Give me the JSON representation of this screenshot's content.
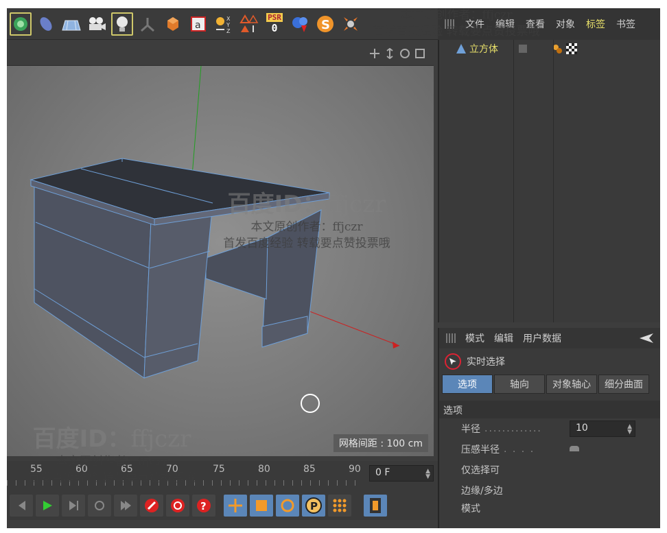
{
  "menubar": {
    "items": [
      "文件",
      "编辑",
      "查看",
      "对象",
      "标签",
      "书签"
    ],
    "active_index": 4
  },
  "toolbar": {
    "psr_label": "PSR",
    "psr_value": "0",
    "axis_labels": "X Y Z"
  },
  "objects": {
    "cube_label": "立方体"
  },
  "viewport": {
    "grid_label": "网格间距 : 100 cm"
  },
  "timeline": {
    "ticks": [
      "55",
      "60",
      "65",
      "70",
      "75",
      "80",
      "85",
      "90"
    ],
    "current_frame": "0 F"
  },
  "attributes": {
    "menu": [
      "模式",
      "编辑",
      "用户数据"
    ],
    "tool_name": "实时选择",
    "tabs": [
      "选项",
      "轴向",
      "对象轴心",
      "细分曲面"
    ],
    "active_tab": 0,
    "section": "选项",
    "props": {
      "radius_label": "半径",
      "radius_value": "10",
      "pressure_label": "压感半径",
      "visible_only_label": "仅选择可",
      "edge_poly_label": "边缘/多边",
      "mode_label": "模式"
    }
  },
  "watermarks": {
    "baidu": "百度ID：",
    "id": "ffjczr",
    "author": "本文原创作者：ffjczr",
    "notice": "首发百度经验 转载要点赞投票哦"
  },
  "colors": {
    "accent_yellow": "#e8e06a",
    "tab_blue": "#5b86b8",
    "mesh_edge": "#6fa0d8",
    "axis_x": "#cc2020",
    "axis_y": "#20a020"
  }
}
